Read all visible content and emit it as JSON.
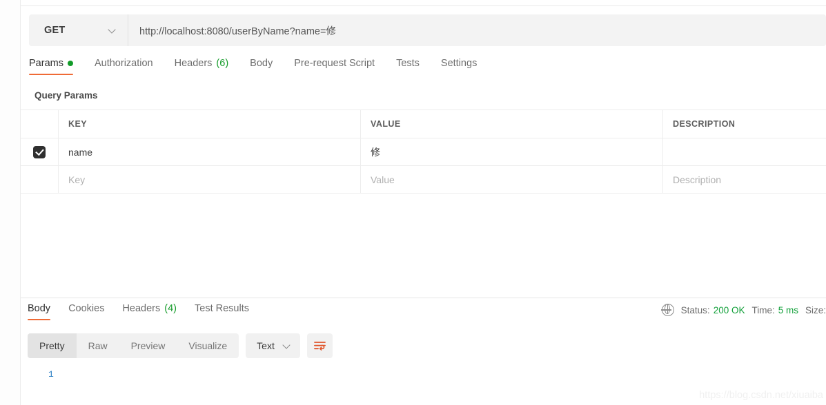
{
  "request": {
    "method": "GET",
    "method_chevron_icon": "chevron-down-icon",
    "url": "http://localhost:8080/userByName?name=修",
    "tabs": [
      {
        "label": "Params",
        "badge": "",
        "badge_type": "dot",
        "active": true
      },
      {
        "label": "Authorization",
        "badge": "",
        "badge_type": "",
        "active": false
      },
      {
        "label": "Headers",
        "badge": "(6)",
        "badge_type": "count",
        "active": false
      },
      {
        "label": "Body",
        "badge": "",
        "badge_type": "",
        "active": false
      },
      {
        "label": "Pre-request Script",
        "badge": "",
        "badge_type": "",
        "active": false
      },
      {
        "label": "Tests",
        "badge": "",
        "badge_type": "",
        "active": false
      },
      {
        "label": "Settings",
        "badge": "",
        "badge_type": "",
        "active": false
      }
    ],
    "query_params": {
      "section_title": "Query Params",
      "columns": [
        "KEY",
        "VALUE",
        "DESCRIPTION"
      ],
      "rows": [
        {
          "checked": true,
          "key": "name",
          "value": "修",
          "description": ""
        }
      ],
      "placeholder_row": {
        "key": "Key",
        "value": "Value",
        "description": "Description"
      }
    }
  },
  "response": {
    "tabs": [
      {
        "label": "Body",
        "badge": "",
        "active": true
      },
      {
        "label": "Cookies",
        "badge": "",
        "active": false
      },
      {
        "label": "Headers",
        "badge": "(4)",
        "active": false
      },
      {
        "label": "Test Results",
        "badge": "",
        "active": false
      }
    ],
    "status": {
      "globe_icon": "globe-icon",
      "status_label": "Status:",
      "status_value": "200 OK",
      "time_label": "Time:",
      "time_value": "5 ms",
      "size_label": "Size:"
    },
    "format_tabs": [
      {
        "label": "Pretty",
        "active": true
      },
      {
        "label": "Raw",
        "active": false
      },
      {
        "label": "Preview",
        "active": false
      },
      {
        "label": "Visualize",
        "active": false
      }
    ],
    "type_select": {
      "value": "Text",
      "chevron_icon": "chevron-down-icon"
    },
    "wrap_button_icon": "word-wrap-icon",
    "body_lines": [
      "1"
    ],
    "body_content": ""
  },
  "watermark": "https://blog.csdn.net/xiuaiba",
  "colors": {
    "accent_orange": "#ef6b36",
    "status_green": "#12a03a",
    "badge_green": "#169c2b",
    "line_number_blue": "#2b7fc4",
    "checkbox_dark": "#2f2f2f"
  }
}
